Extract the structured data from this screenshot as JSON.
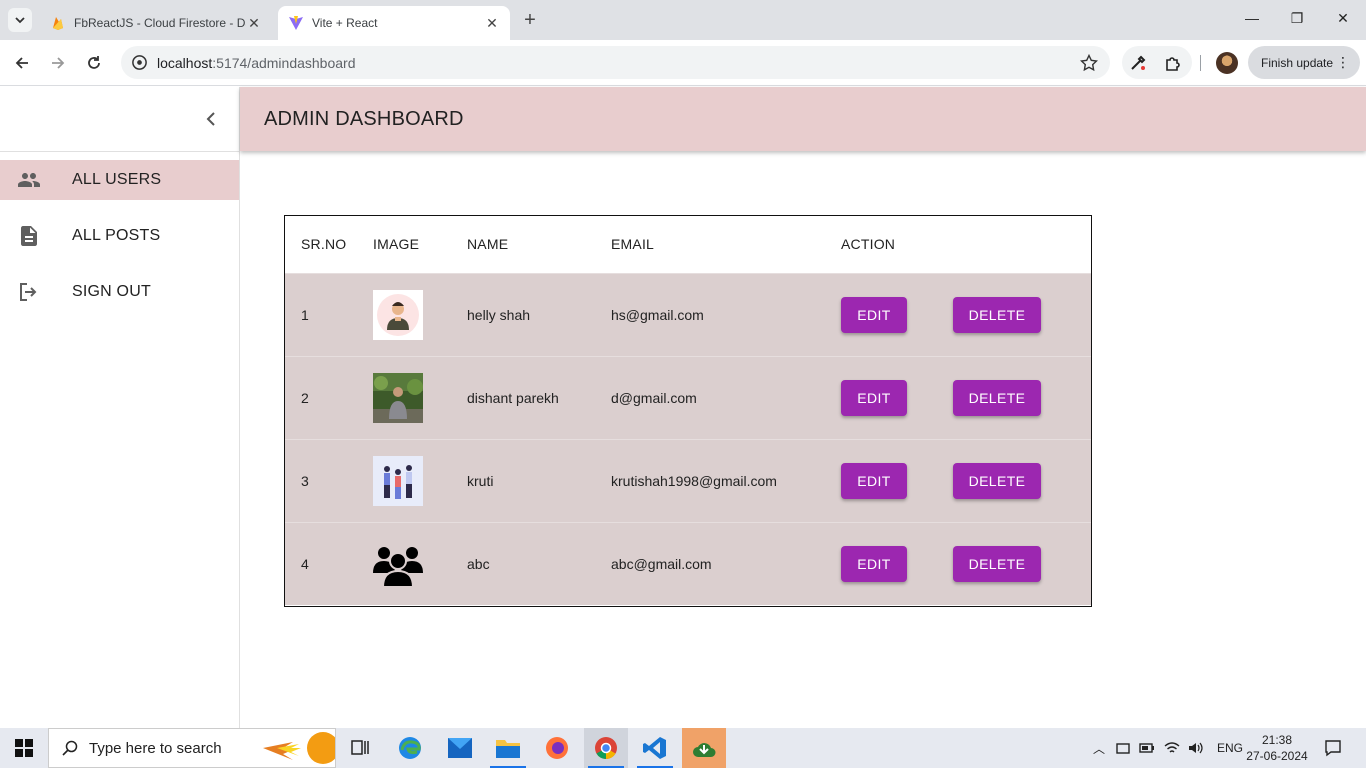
{
  "browser": {
    "tabs": [
      {
        "title": "FbReactJS - Cloud Firestore - Da",
        "active": false
      },
      {
        "title": "Vite + React",
        "active": true
      }
    ],
    "url_host": "localhost",
    "url_path": ":5174/admindashboard",
    "finish_update_label": "Finish update"
  },
  "app": {
    "title": "ADMIN DASHBOARD",
    "sidebar": {
      "items": [
        {
          "label": "ALL USERS",
          "icon": "people-icon",
          "selected": true
        },
        {
          "label": "ALL POSTS",
          "icon": "article-icon",
          "selected": false
        },
        {
          "label": "SIGN OUT",
          "icon": "logout-icon",
          "selected": false
        }
      ]
    },
    "table": {
      "headers": [
        "SR.NO",
        "IMAGE",
        "NAME",
        "EMAIL",
        "ACTION"
      ],
      "edit_label": "EDIT",
      "delete_label": "DELETE",
      "rows": [
        {
          "sr": "1",
          "name": "helly shah",
          "email": "hs@gmail.com",
          "image": "avatar-man-icon"
        },
        {
          "sr": "2",
          "name": "dishant parekh",
          "email": "d@gmail.com",
          "image": "photo-garden"
        },
        {
          "sr": "3",
          "name": "kruti",
          "email": "krutishah1998@gmail.com",
          "image": "people-illustration"
        },
        {
          "sr": "4",
          "name": "abc",
          "email": "abc@gmail.com",
          "image": "group-icon"
        }
      ]
    }
  },
  "taskbar": {
    "search_placeholder": "Type here to search",
    "language": "ENG",
    "time": "21:38",
    "date": "27-06-2024"
  },
  "colors": {
    "appbar": "#e8cdce",
    "row": "#dbcfcf",
    "button": "#9c27b0"
  }
}
